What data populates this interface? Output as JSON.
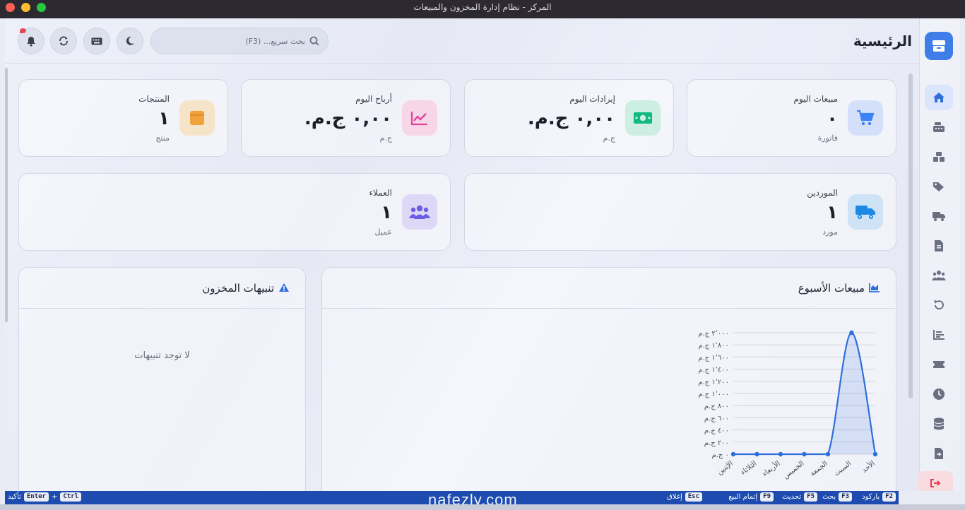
{
  "window": {
    "title": "المركز - نظام إدارة المخزون والمبيعات"
  },
  "header": {
    "title": "الرئيسية",
    "search_placeholder": "بحث سريع... (F3)"
  },
  "stats": [
    {
      "label": "مبيعات اليوم",
      "value": "٠",
      "unit": "فاتورة",
      "icon": "cart-icon",
      "color": "#3b82f6",
      "bg": "#d4e0fa"
    },
    {
      "label": "إيرادات اليوم",
      "value": "٠,٠٠ ج.م.",
      "unit": "ج.م",
      "icon": "money-icon",
      "color": "#10b981",
      "bg": "#cdeee2"
    },
    {
      "label": "أرباح اليوم",
      "value": "٠,٠٠ ج.م.",
      "unit": "ج.م",
      "icon": "trend-icon",
      "color": "#e0439a",
      "bg": "#f7d6e8"
    },
    {
      "label": "المنتجات",
      "value": "١",
      "unit": "منتج",
      "icon": "box-icon",
      "color": "#f2a23a",
      "bg": "#f6e4c9"
    },
    {
      "label": "الموردين",
      "value": "١",
      "unit": "مورد",
      "icon": "truck-icon",
      "color": "#1e88e5",
      "bg": "#cfe3f7"
    },
    {
      "label": "العملاء",
      "value": "١",
      "unit": "عميل",
      "icon": "users-icon",
      "color": "#6c5ce7",
      "bg": "#dcd8f6"
    }
  ],
  "sales_panel": {
    "title": "مبيعات الأسبوع"
  },
  "alerts_panel": {
    "title": "تنبيهات المخزون",
    "empty_text": "لا توجد تنبيهات"
  },
  "chart_data": {
    "type": "line",
    "categories": [
      "الأحد",
      "السبت",
      "الجمعة",
      "الخميس",
      "الأربعاء",
      "الثلاثاء",
      "الإثنين"
    ],
    "y_tick_labels": [
      "٠ ج.م",
      "٢٠٠ ج.م",
      "٤٠٠ ج.م",
      "٦٠٠ ج.م",
      "٨٠٠ ج.م",
      "١٬٠٠٠ ج.م",
      "١٬٢٠٠ ج.م",
      "١٬٤٠٠ ج.م",
      "١٬٦٠٠ ج.م",
      "١٬٨٠٠ ج.م",
      "٢٬٠٠٠ ج.م"
    ],
    "series": [
      {
        "values": [
          0,
          2000,
          0,
          0,
          0,
          0,
          0
        ]
      }
    ],
    "ylim": [
      0,
      2000
    ],
    "grid": true,
    "color": "#2f6fdc"
  },
  "statusbar": [
    {
      "key": "F2",
      "label": "باركود"
    },
    {
      "key": "F3",
      "label": "بحث"
    },
    {
      "key": "F5",
      "label": "تحديث"
    },
    {
      "key": "F9",
      "label": "إتمام البيع"
    },
    {
      "key": "Esc",
      "label": "إغلاق"
    }
  ],
  "statusbar_combo": {
    "key1": "Ctrl",
    "key2": "Enter",
    "label": "تأكيد"
  },
  "watermark": "nafezly.com"
}
